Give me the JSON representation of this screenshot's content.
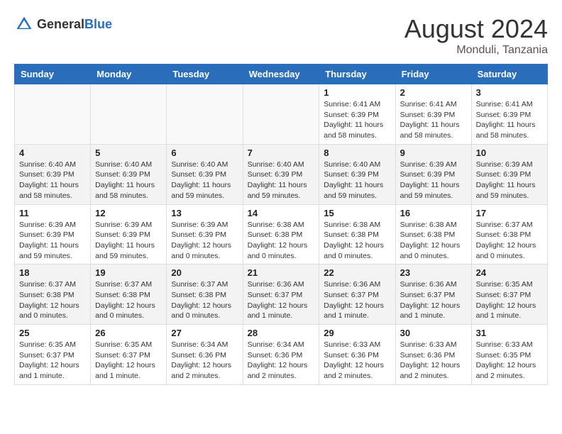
{
  "logo": {
    "general": "General",
    "blue": "Blue"
  },
  "title": {
    "month_year": "August 2024",
    "location": "Monduli, Tanzania"
  },
  "weekdays": [
    "Sunday",
    "Monday",
    "Tuesday",
    "Wednesday",
    "Thursday",
    "Friday",
    "Saturday"
  ],
  "weeks": [
    [
      {
        "day": "",
        "info": ""
      },
      {
        "day": "",
        "info": ""
      },
      {
        "day": "",
        "info": ""
      },
      {
        "day": "",
        "info": ""
      },
      {
        "day": "1",
        "info": "Sunrise: 6:41 AM\nSunset: 6:39 PM\nDaylight: 11 hours and 58 minutes."
      },
      {
        "day": "2",
        "info": "Sunrise: 6:41 AM\nSunset: 6:39 PM\nDaylight: 11 hours and 58 minutes."
      },
      {
        "day": "3",
        "info": "Sunrise: 6:41 AM\nSunset: 6:39 PM\nDaylight: 11 hours and 58 minutes."
      }
    ],
    [
      {
        "day": "4",
        "info": "Sunrise: 6:40 AM\nSunset: 6:39 PM\nDaylight: 11 hours and 58 minutes."
      },
      {
        "day": "5",
        "info": "Sunrise: 6:40 AM\nSunset: 6:39 PM\nDaylight: 11 hours and 58 minutes."
      },
      {
        "day": "6",
        "info": "Sunrise: 6:40 AM\nSunset: 6:39 PM\nDaylight: 11 hours and 59 minutes."
      },
      {
        "day": "7",
        "info": "Sunrise: 6:40 AM\nSunset: 6:39 PM\nDaylight: 11 hours and 59 minutes."
      },
      {
        "day": "8",
        "info": "Sunrise: 6:40 AM\nSunset: 6:39 PM\nDaylight: 11 hours and 59 minutes."
      },
      {
        "day": "9",
        "info": "Sunrise: 6:39 AM\nSunset: 6:39 PM\nDaylight: 11 hours and 59 minutes."
      },
      {
        "day": "10",
        "info": "Sunrise: 6:39 AM\nSunset: 6:39 PM\nDaylight: 11 hours and 59 minutes."
      }
    ],
    [
      {
        "day": "11",
        "info": "Sunrise: 6:39 AM\nSunset: 6:39 PM\nDaylight: 11 hours and 59 minutes."
      },
      {
        "day": "12",
        "info": "Sunrise: 6:39 AM\nSunset: 6:39 PM\nDaylight: 11 hours and 59 minutes."
      },
      {
        "day": "13",
        "info": "Sunrise: 6:39 AM\nSunset: 6:39 PM\nDaylight: 12 hours and 0 minutes."
      },
      {
        "day": "14",
        "info": "Sunrise: 6:38 AM\nSunset: 6:38 PM\nDaylight: 12 hours and 0 minutes."
      },
      {
        "day": "15",
        "info": "Sunrise: 6:38 AM\nSunset: 6:38 PM\nDaylight: 12 hours and 0 minutes."
      },
      {
        "day": "16",
        "info": "Sunrise: 6:38 AM\nSunset: 6:38 PM\nDaylight: 12 hours and 0 minutes."
      },
      {
        "day": "17",
        "info": "Sunrise: 6:37 AM\nSunset: 6:38 PM\nDaylight: 12 hours and 0 minutes."
      }
    ],
    [
      {
        "day": "18",
        "info": "Sunrise: 6:37 AM\nSunset: 6:38 PM\nDaylight: 12 hours and 0 minutes."
      },
      {
        "day": "19",
        "info": "Sunrise: 6:37 AM\nSunset: 6:38 PM\nDaylight: 12 hours and 0 minutes."
      },
      {
        "day": "20",
        "info": "Sunrise: 6:37 AM\nSunset: 6:38 PM\nDaylight: 12 hours and 0 minutes."
      },
      {
        "day": "21",
        "info": "Sunrise: 6:36 AM\nSunset: 6:37 PM\nDaylight: 12 hours and 1 minute."
      },
      {
        "day": "22",
        "info": "Sunrise: 6:36 AM\nSunset: 6:37 PM\nDaylight: 12 hours and 1 minute."
      },
      {
        "day": "23",
        "info": "Sunrise: 6:36 AM\nSunset: 6:37 PM\nDaylight: 12 hours and 1 minute."
      },
      {
        "day": "24",
        "info": "Sunrise: 6:35 AM\nSunset: 6:37 PM\nDaylight: 12 hours and 1 minute."
      }
    ],
    [
      {
        "day": "25",
        "info": "Sunrise: 6:35 AM\nSunset: 6:37 PM\nDaylight: 12 hours and 1 minute."
      },
      {
        "day": "26",
        "info": "Sunrise: 6:35 AM\nSunset: 6:37 PM\nDaylight: 12 hours and 1 minute."
      },
      {
        "day": "27",
        "info": "Sunrise: 6:34 AM\nSunset: 6:36 PM\nDaylight: 12 hours and 2 minutes."
      },
      {
        "day": "28",
        "info": "Sunrise: 6:34 AM\nSunset: 6:36 PM\nDaylight: 12 hours and 2 minutes."
      },
      {
        "day": "29",
        "info": "Sunrise: 6:33 AM\nSunset: 6:36 PM\nDaylight: 12 hours and 2 minutes."
      },
      {
        "day": "30",
        "info": "Sunrise: 6:33 AM\nSunset: 6:36 PM\nDaylight: 12 hours and 2 minutes."
      },
      {
        "day": "31",
        "info": "Sunrise: 6:33 AM\nSunset: 6:35 PM\nDaylight: 12 hours and 2 minutes."
      }
    ]
  ]
}
